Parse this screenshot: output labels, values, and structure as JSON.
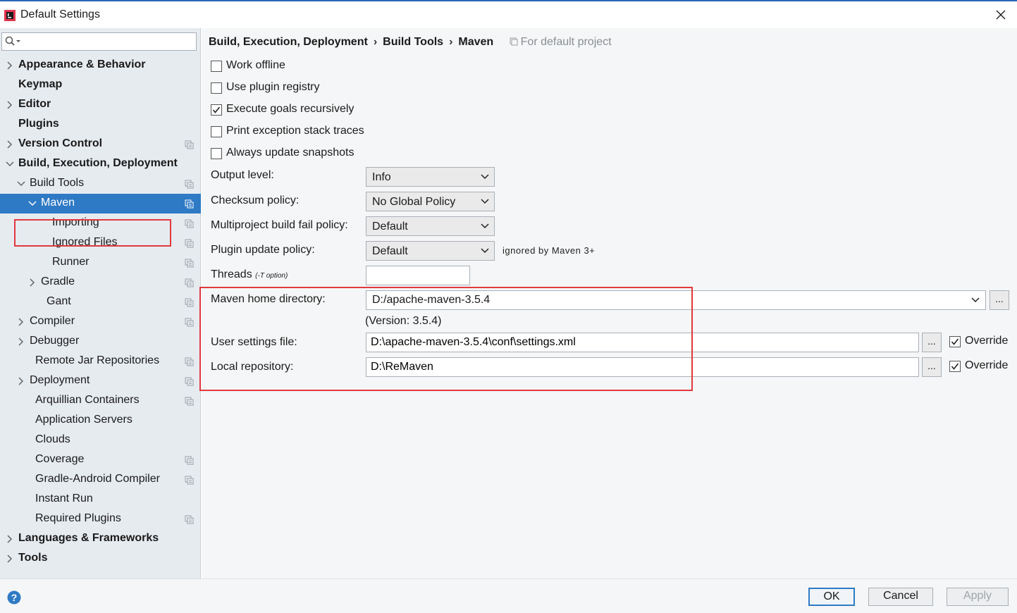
{
  "window": {
    "title": "Default Settings"
  },
  "search": {
    "placeholder": ""
  },
  "tree": [
    {
      "label": "Appearance & Behavior",
      "level": 0,
      "bold": true,
      "arrow": "right",
      "proj": false
    },
    {
      "label": "Keymap",
      "level": 0,
      "bold": true,
      "arrow": "none",
      "proj": false
    },
    {
      "label": "Editor",
      "level": 0,
      "bold": true,
      "arrow": "right",
      "proj": false
    },
    {
      "label": "Plugins",
      "level": 0,
      "bold": true,
      "arrow": "none",
      "proj": false
    },
    {
      "label": "Version Control",
      "level": 0,
      "bold": true,
      "arrow": "right",
      "proj": true
    },
    {
      "label": "Build, Execution, Deployment",
      "level": 0,
      "bold": true,
      "arrow": "down",
      "proj": false
    },
    {
      "label": "Build Tools",
      "level": 1,
      "bold": false,
      "arrow": "down",
      "proj": true
    },
    {
      "label": "Maven",
      "level": 2,
      "bold": false,
      "arrow": "down",
      "proj": true,
      "selected": true
    },
    {
      "label": "Importing",
      "level": 3,
      "bold": false,
      "arrow": "none",
      "proj": true
    },
    {
      "label": "Ignored Files",
      "level": 3,
      "bold": false,
      "arrow": "none",
      "proj": true
    },
    {
      "label": "Runner",
      "level": 3,
      "bold": false,
      "arrow": "none",
      "proj": true
    },
    {
      "label": "Gradle",
      "level": 2,
      "bold": false,
      "arrow": "right",
      "proj": true
    },
    {
      "label": "Gant",
      "level": 2.5,
      "bold": false,
      "arrow": "none",
      "proj": true
    },
    {
      "label": "Compiler",
      "level": 1,
      "bold": false,
      "arrow": "right",
      "proj": true
    },
    {
      "label": "Debugger",
      "level": 1,
      "bold": false,
      "arrow": "right",
      "proj": false
    },
    {
      "label": "Remote Jar Repositories",
      "level": 1.5,
      "bold": false,
      "arrow": "none",
      "proj": true
    },
    {
      "label": "Deployment",
      "level": 1,
      "bold": false,
      "arrow": "right",
      "proj": true
    },
    {
      "label": "Arquillian Containers",
      "level": 1.5,
      "bold": false,
      "arrow": "none",
      "proj": true
    },
    {
      "label": "Application Servers",
      "level": 1.5,
      "bold": false,
      "arrow": "none",
      "proj": false
    },
    {
      "label": "Clouds",
      "level": 1.5,
      "bold": false,
      "arrow": "none",
      "proj": false
    },
    {
      "label": "Coverage",
      "level": 1.5,
      "bold": false,
      "arrow": "none",
      "proj": true
    },
    {
      "label": "Gradle-Android Compiler",
      "level": 1.5,
      "bold": false,
      "arrow": "none",
      "proj": true
    },
    {
      "label": "Instant Run",
      "level": 1.5,
      "bold": false,
      "arrow": "none",
      "proj": false
    },
    {
      "label": "Required Plugins",
      "level": 1.5,
      "bold": false,
      "arrow": "none",
      "proj": true
    },
    {
      "label": "Languages & Frameworks",
      "level": 0,
      "bold": true,
      "arrow": "right",
      "proj": false
    },
    {
      "label": "Tools",
      "level": 0,
      "bold": true,
      "arrow": "right",
      "proj": false
    }
  ],
  "breadcrumb": {
    "items": [
      "Build, Execution, Deployment",
      "Build Tools",
      "Maven"
    ],
    "separator": "›",
    "note": "For default project"
  },
  "options": [
    {
      "label": "Work offline",
      "checked": false
    },
    {
      "label": "Use plugin registry",
      "checked": false
    },
    {
      "label": "Execute goals recursively",
      "checked": true
    },
    {
      "label": "Print exception stack traces",
      "checked": false
    },
    {
      "label": "Always update snapshots",
      "checked": false
    }
  ],
  "fields": {
    "output_level": {
      "label": "Output level:",
      "value": "Info"
    },
    "checksum_policy": {
      "label": "Checksum policy:",
      "value": "No Global Policy"
    },
    "multiproject_policy": {
      "label": "Multiproject build fail policy:",
      "value": "Default"
    },
    "plugin_update_policy": {
      "label": "Plugin update policy:",
      "value": "Default",
      "hint": "ignored by Maven 3+"
    },
    "threads": {
      "label": "Threads",
      "sublabel": "(-T option)",
      "value": ""
    },
    "maven_home": {
      "label": "Maven home directory:",
      "value": "D:/apache-maven-3.5.4",
      "version": "(Version: 3.5.4)"
    },
    "user_settings": {
      "label": "User settings file:",
      "value": "D:\\apache-maven-3.5.4\\conf\\settings.xml",
      "override_label": "Override",
      "override": true
    },
    "local_repo": {
      "label": "Local repository:",
      "value": "D:\\ReMaven",
      "override_label": "Override",
      "override": true
    }
  },
  "browse_label": "...",
  "buttons": {
    "ok": "OK",
    "cancel": "Cancel",
    "apply": "Apply"
  },
  "colors": {
    "selection": "#2f7ac5",
    "sidebar_bg": "#e6ebf0",
    "highlight_box": "#e0393d"
  }
}
